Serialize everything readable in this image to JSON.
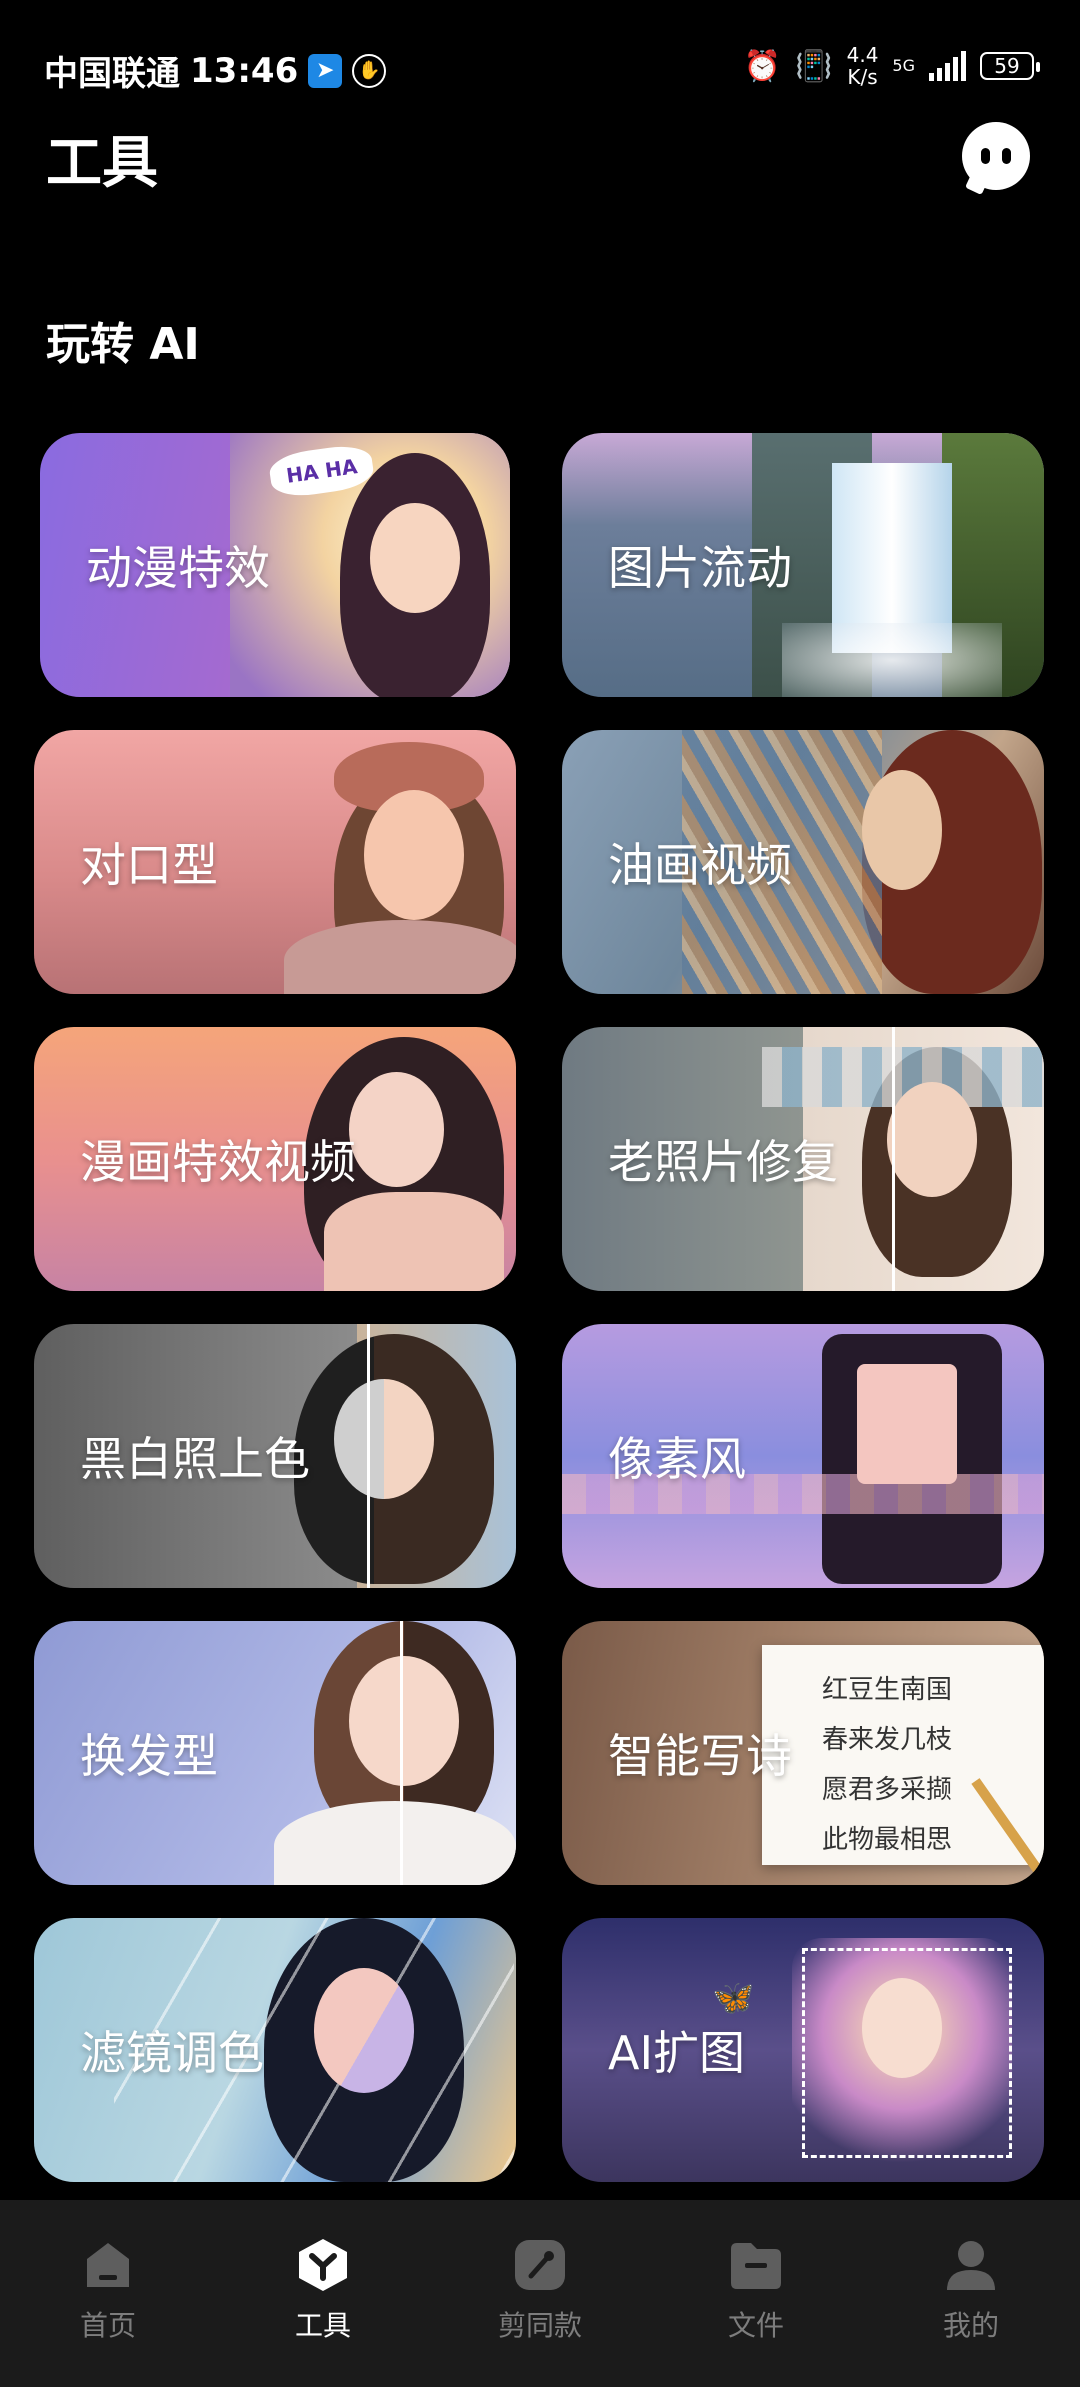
{
  "status_bar": {
    "carrier": "中国联通",
    "time": "13:46",
    "speed_top": "4.4",
    "speed_bottom": "K/s",
    "network": "5G",
    "battery": "59"
  },
  "header": {
    "title": "工具"
  },
  "section": {
    "title": "玩转 AI"
  },
  "cards": [
    {
      "label": "动漫特效",
      "icon": "anime-effect",
      "badge": "HA HA"
    },
    {
      "label": "图片流动",
      "icon": "image-flow"
    },
    {
      "label": "对口型",
      "icon": "lip-sync"
    },
    {
      "label": "油画视频",
      "icon": "oil-painting-video"
    },
    {
      "label": "漫画特效视频",
      "icon": "comic-effect-video"
    },
    {
      "label": "老照片修复",
      "icon": "old-photo-restore"
    },
    {
      "label": "黑白照上色",
      "icon": "bw-colorize"
    },
    {
      "label": "像素风",
      "icon": "pixel-style"
    },
    {
      "label": "换发型",
      "icon": "hairstyle-change"
    },
    {
      "label": "智能写诗",
      "icon": "ai-poem",
      "poem": [
        "红豆生南国",
        "春来发几枝",
        "愿君多采撷",
        "此物最相思"
      ]
    },
    {
      "label": "滤镜调色",
      "icon": "filter-color"
    },
    {
      "label": "AI扩图",
      "icon": "ai-expand"
    }
  ],
  "bottom_nav": [
    {
      "label": "首页",
      "icon": "home-icon",
      "active": false
    },
    {
      "label": "工具",
      "icon": "tools-icon",
      "active": true
    },
    {
      "label": "剪同款",
      "icon": "template-icon",
      "active": false
    },
    {
      "label": "文件",
      "icon": "folder-icon",
      "active": false
    },
    {
      "label": "我的",
      "icon": "profile-icon",
      "active": false
    }
  ],
  "colors": {
    "background": "#000000",
    "nav_bg": "#1b1b1b",
    "nav_inactive": "#7d7d7d",
    "nav_active": "#ffffff"
  }
}
